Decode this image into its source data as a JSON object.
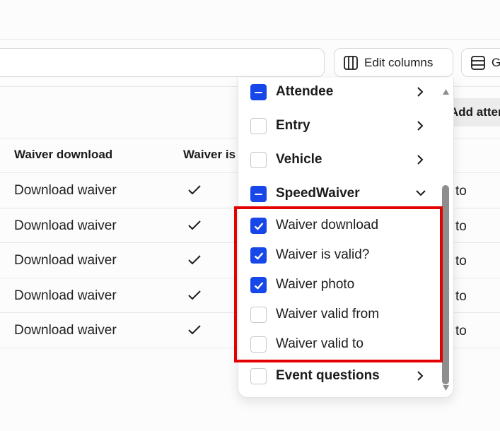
{
  "toolbar": {
    "edit_columns_label": "Edit columns",
    "group_label": "G"
  },
  "add_attendee_label": "Add attendee",
  "table": {
    "columns": [
      "Waiver download",
      "Waiver is valid?"
    ],
    "rows": [
      {
        "waiver_download": "Download waiver",
        "valid": true,
        "tail": "to"
      },
      {
        "waiver_download": "Download waiver",
        "valid": true,
        "tail": "to"
      },
      {
        "waiver_download": "Download waiver",
        "valid": true,
        "tail": "to"
      },
      {
        "waiver_download": "Download waiver",
        "valid": true,
        "tail": "to"
      },
      {
        "waiver_download": "Download waiver",
        "valid": true,
        "tail": "to"
      }
    ]
  },
  "column_menu": {
    "groups": {
      "attendee": {
        "label": "Attendee",
        "state": "mixed"
      },
      "entry": {
        "label": "Entry",
        "state": "unchecked"
      },
      "vehicle": {
        "label": "Vehicle",
        "state": "unchecked"
      },
      "speedwaiver": {
        "label": "SpeedWaiver",
        "state": "mixed",
        "expanded": true
      },
      "event_questions": {
        "label": "Event questions",
        "state": "unchecked"
      }
    },
    "speedwaiver_items": [
      {
        "label": "Waiver download",
        "checked": true
      },
      {
        "label": "Waiver is valid?",
        "checked": true
      },
      {
        "label": "Waiver photo",
        "checked": true
      },
      {
        "label": "Waiver valid from",
        "checked": false
      },
      {
        "label": "Waiver valid to",
        "checked": false
      }
    ]
  },
  "colors": {
    "accent": "#1747e8",
    "highlight": "#e20000",
    "scrollbar": "#8e8e8e"
  },
  "icons": {
    "edit_columns": "columns-icon",
    "group": "rows-icon",
    "row_check": "checkmark-icon",
    "submenu": "chevron-right-icon",
    "expanded": "chevron-down-icon"
  }
}
